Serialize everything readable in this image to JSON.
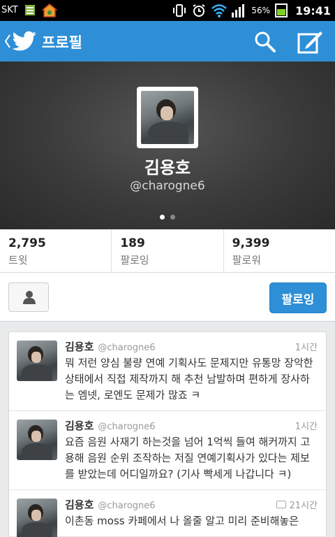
{
  "status_bar": {
    "carrier": "SKT",
    "battery_percent": "56%",
    "time": "19:41"
  },
  "action_bar": {
    "title": "프로필"
  },
  "profile": {
    "name": "김용호",
    "handle": "@charogne6",
    "pager_dots": 2,
    "active_dot": 0
  },
  "stats": [
    {
      "value": "2,795",
      "label": "트윗"
    },
    {
      "value": "189",
      "label": "팔로잉"
    },
    {
      "value": "9,399",
      "label": "팔로워"
    }
  ],
  "follow_button": {
    "label": "팔로잉"
  },
  "tweets": [
    {
      "name": "김용호",
      "handle": "@charogne6",
      "time": "1시간",
      "has_media": false,
      "text": "뭐 저런 양심 불량 연예 기획사도 문제지만 유통망 장악한 상태에서 직접 제작까지 해 추천 남발하며 편하게 장사하는 엠넷, 로엔도 문제가 많죠 ㅋ"
    },
    {
      "name": "김용호",
      "handle": "@charogne6",
      "time": "1시간",
      "has_media": false,
      "text": "요즘 음원 사재기 하는것을 넘어 1억씩 들여 해커까지 고용해 음원 순위 조작하는 저질 연예기획사가 있다는 제보를 받았는데 어디일까요? (기사 빡세게 나갑니다 ㅋ)"
    },
    {
      "name": "김용호",
      "handle": "@charogne6",
      "time": "21시간",
      "has_media": true,
      "text": "이촌동 moss 카페에서 나 올줄 알고 미리 준비해놓은"
    }
  ]
}
